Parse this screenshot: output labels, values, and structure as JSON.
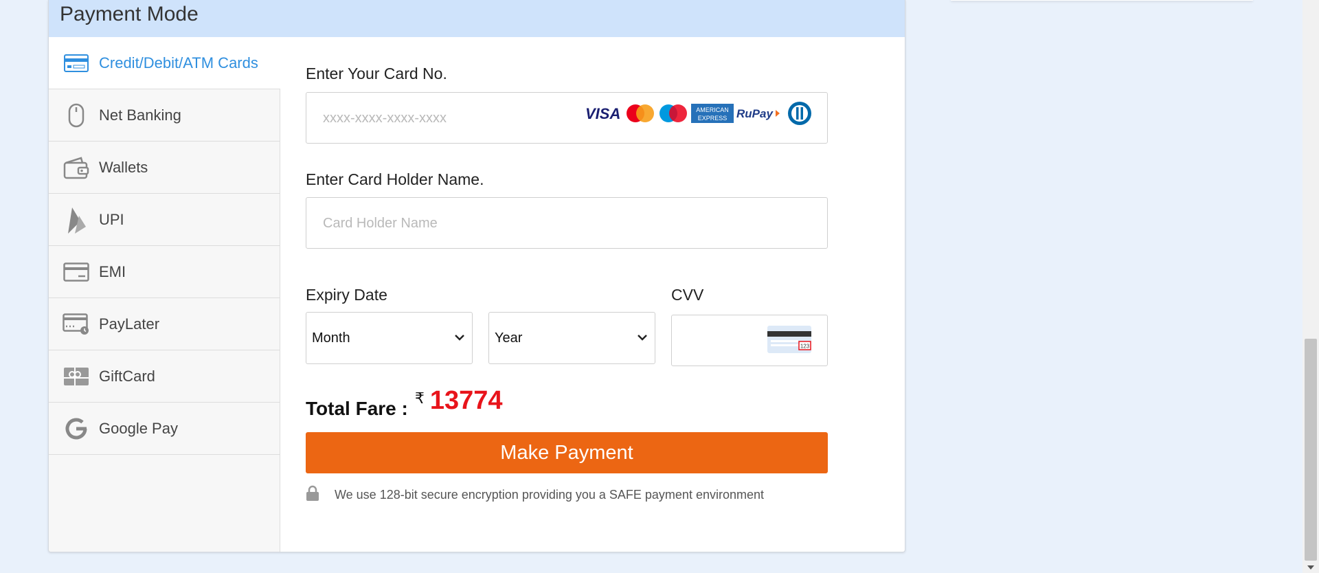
{
  "header": {
    "title": "Payment Mode"
  },
  "sidebar": {
    "items": [
      {
        "label": "Credit/Debit/ATM Cards",
        "icon": "credit-card-icon",
        "active": true
      },
      {
        "label": "Net Banking",
        "icon": "mouse-icon"
      },
      {
        "label": "Wallets",
        "icon": "wallet-icon"
      },
      {
        "label": "UPI",
        "icon": "upi-icon"
      },
      {
        "label": "EMI",
        "icon": "emi-card-icon"
      },
      {
        "label": "PayLater",
        "icon": "paylater-icon"
      },
      {
        "label": "GiftCard",
        "icon": "giftcard-icon"
      },
      {
        "label": "Google Pay",
        "icon": "google-g-icon"
      }
    ]
  },
  "form": {
    "card_no_label": "Enter Your Card No.",
    "card_no_placeholder": "xxxx-xxxx-xxxx-xxxx",
    "card_logos": [
      "VISA",
      "MasterCard",
      "Maestro",
      "AMERICAN EXPRESS",
      "RuPay",
      "Diners Club"
    ],
    "holder_label": "Enter Card Holder Name.",
    "holder_placeholder": "Card Holder Name",
    "expiry_label": "Expiry Date",
    "month_value": "Month",
    "year_value": "Year",
    "cvv_label": "CVV",
    "cvv_card_text": "123"
  },
  "fare": {
    "label": "Total Fare :",
    "currency": "₹",
    "amount": "13774"
  },
  "actions": {
    "pay_label": "Make Payment"
  },
  "security": {
    "text": "We use 128-bit secure encryption providing you a SAFE payment environment"
  },
  "colors": {
    "accent": "#2f8fdf",
    "pay_button": "#ec6613",
    "fare_amount": "#e8141b",
    "header_bg": "#cfe3fb"
  }
}
